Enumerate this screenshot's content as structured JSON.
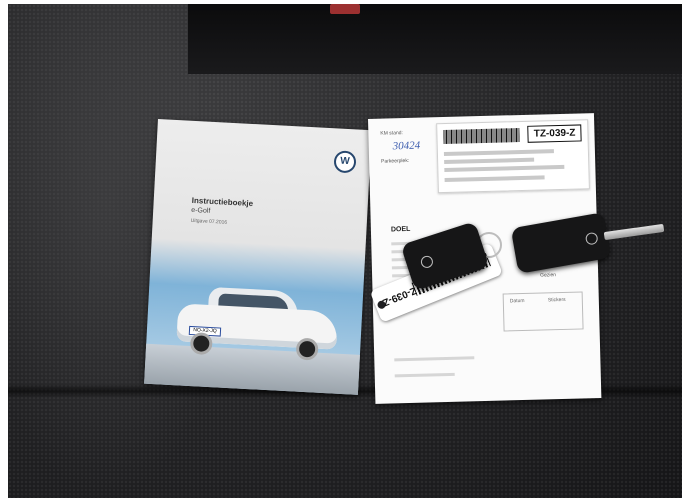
{
  "scene": {
    "description_visible_text_only": true
  },
  "booklet": {
    "title": "Instructieboekje",
    "subtitle": "e-Golf",
    "edition": "Uitgave 07.2016",
    "plate": "NO-X2-JQ"
  },
  "document": {
    "label_top": "KM stand:",
    "signature": "30424",
    "label_parking": "Parkeerplek:",
    "heading": "DOEL",
    "sticker_plate": "TZ-039-Z",
    "box_labels": [
      "Datum",
      "Stickers"
    ],
    "check_label": "Gezien"
  },
  "tag": {
    "plate": "TZ-039-Z"
  },
  "colors": {
    "seat": "#232325",
    "manual_blue": "#7fb3d8",
    "paper": "#fbfbfb",
    "key": "#161617"
  }
}
